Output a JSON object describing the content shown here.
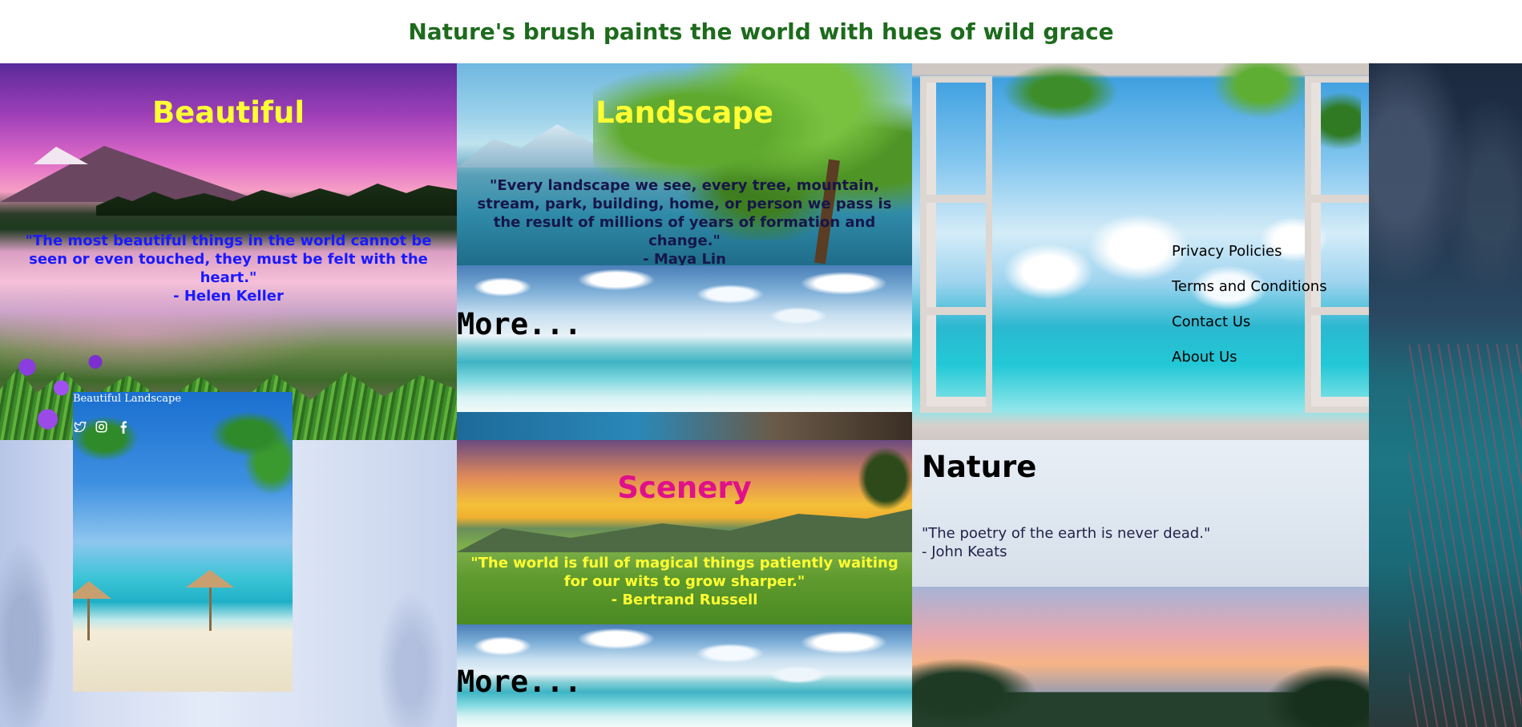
{
  "header": {
    "title": "Nature's brush paints the world with hues of wild grace",
    "title_color": "#1d6b1d"
  },
  "panels": {
    "beautiful": {
      "title": "Beautiful",
      "title_color": "#ffff33",
      "quote": "\"The most beautiful things in the world cannot be seen or even touched, they must be felt with the heart.\"",
      "author": "- Helen Keller",
      "quote_color": "#1a1aff"
    },
    "landscape": {
      "title": "Landscape",
      "title_color": "#ffff33",
      "quote": "\"Every landscape we see, every tree, mountain, stream, park, building, home, or person we pass is the result of millions of years of formation and change.\"",
      "author": "- Maya Lin",
      "quote_color": "#16164a"
    },
    "scenery": {
      "title": "Scenery",
      "title_color": "#e0108a",
      "quote": "\"The world is full of magical things patiently waiting for our wits to grow sharper.\"",
      "author": "- Bertrand Russell",
      "quote_color": "#ffff33"
    },
    "nature": {
      "title": "Nature",
      "quote": "\"The poetry of the earth is never dead.\"",
      "author": "- John Keats",
      "quote_color": "#22224a"
    },
    "more1": {
      "label": "More..."
    },
    "more2": {
      "label": "More..."
    }
  },
  "card": {
    "brand": "Beautiful Landscape",
    "social_icons": [
      "twitter-icon",
      "instagram-icon",
      "facebook-icon"
    ]
  },
  "menu": {
    "items": [
      "Privacy Policies",
      "Terms and Conditions",
      "Contact Us",
      "About Us"
    ]
  }
}
